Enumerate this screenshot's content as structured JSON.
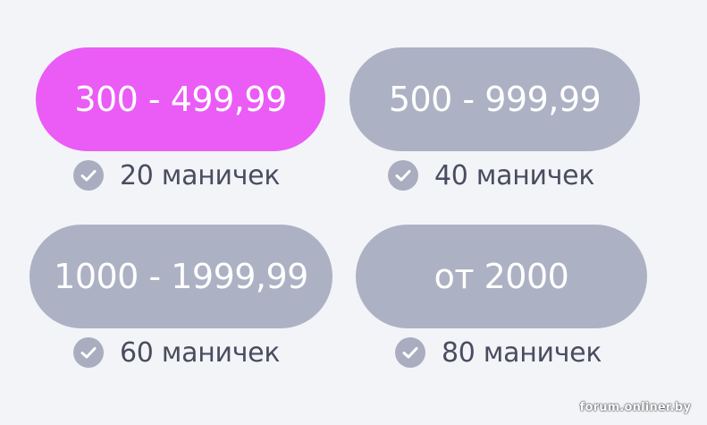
{
  "tiers": [
    {
      "range": "300 - 499,99",
      "reward": "20 маничек",
      "active": true
    },
    {
      "range": "500 - 999,99",
      "reward": "40 маничек",
      "active": false
    },
    {
      "range": "1000 - 1999,99",
      "reward": "60 маничек",
      "active": false
    },
    {
      "range": "от 2000",
      "reward": "80 маничек",
      "active": false
    }
  ],
  "icons": {
    "reward_check": "check-circle-icon"
  },
  "colors": {
    "active_pill": "#ea5cf5",
    "inactive_pill": "#adb1c4",
    "check_bg": "#a9adbf",
    "reward_text": "#4a4d5f",
    "background": "#f3f4f8"
  },
  "watermark": "forum.onliner.by"
}
